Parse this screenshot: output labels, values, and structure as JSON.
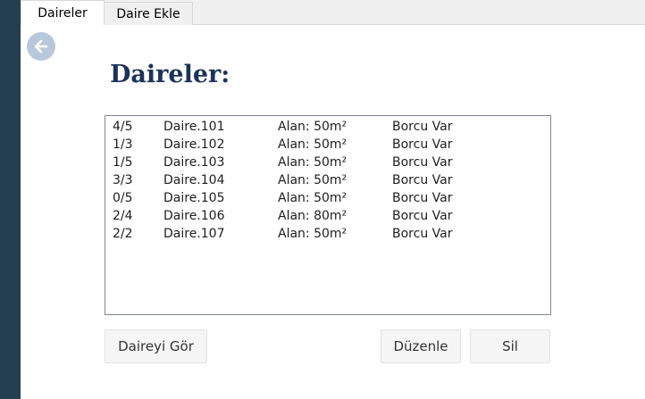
{
  "tabs": [
    {
      "label": "Daireler"
    },
    {
      "label": "Daire Ekle"
    }
  ],
  "page": {
    "title": "Daireler:"
  },
  "apartments": [
    {
      "ratio": "4/5",
      "name": "Daire.101",
      "area": "Alan: 50m²",
      "status": "Borcu Var"
    },
    {
      "ratio": "1/3",
      "name": "Daire.102",
      "area": "Alan: 50m²",
      "status": "Borcu Var"
    },
    {
      "ratio": "1/5",
      "name": "Daire.103",
      "area": "Alan: 50m²",
      "status": "Borcu Var"
    },
    {
      "ratio": "3/3",
      "name": "Daire.104",
      "area": "Alan: 50m²",
      "status": "Borcu Var"
    },
    {
      "ratio": "0/5",
      "name": "Daire.105",
      "area": "Alan: 50m²",
      "status": "Borcu Var"
    },
    {
      "ratio": "2/4",
      "name": "Daire.106",
      "area": "Alan: 80m²",
      "status": "Borcu Var"
    },
    {
      "ratio": "2/2",
      "name": "Daire.107",
      "area": "Alan: 50m²",
      "status": "Borcu Var"
    }
  ],
  "buttons": {
    "view": "Daireyi Gör",
    "edit": "Düzenle",
    "delete": "Sil"
  },
  "icons": {
    "back": "arrow-left-icon"
  },
  "colors": {
    "sidebar": "#243f4f",
    "title": "#1c3358",
    "back_button": "#b8c8dc"
  }
}
